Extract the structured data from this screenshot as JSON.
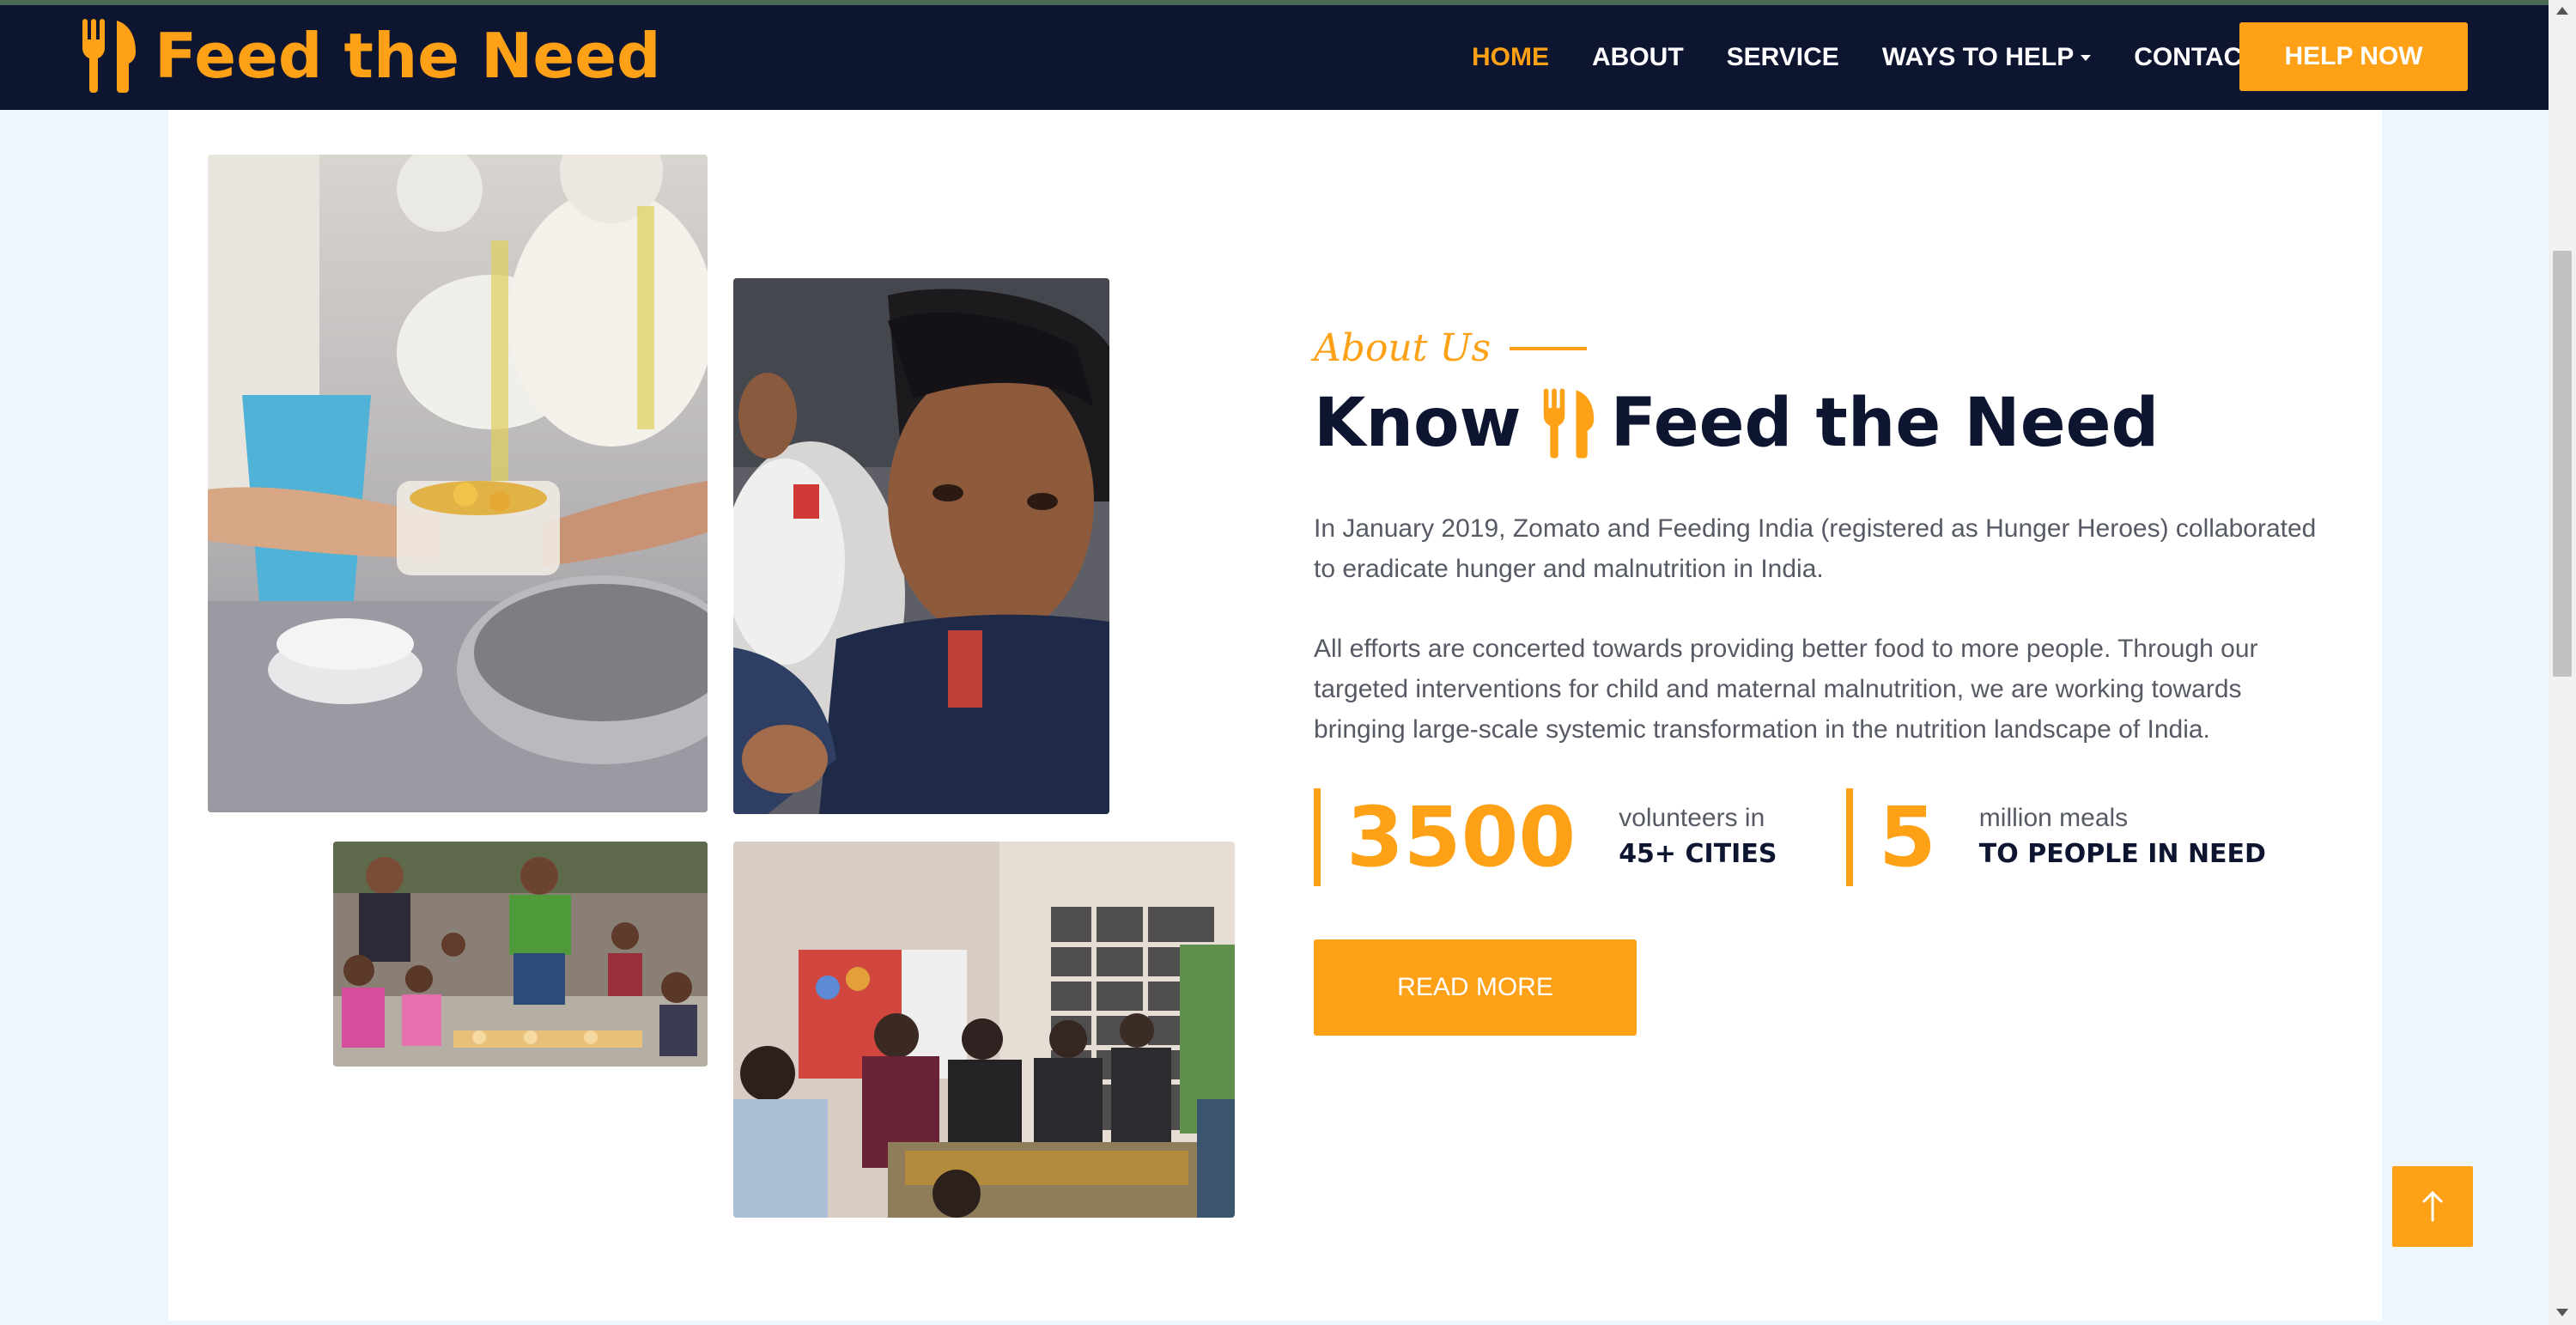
{
  "colors": {
    "accent": "#fea116",
    "navy": "#0d1530",
    "page_background": "#edf5fd",
    "body_text": "#555a64"
  },
  "brand": {
    "name": "Feed the Need",
    "icon": "fork-knife-icon"
  },
  "nav": {
    "items": [
      {
        "label": "HOME",
        "active": true
      },
      {
        "label": "ABOUT",
        "active": false
      },
      {
        "label": "SERVICE",
        "active": false
      },
      {
        "label": "WAYS TO HELP",
        "active": false,
        "dropdown": true
      },
      {
        "label": "CONTACT",
        "active": false
      }
    ],
    "cta_label": "HELP NOW"
  },
  "about": {
    "label": "About Us",
    "heading_prefix": "Know",
    "heading_icon": "fork-knife-icon",
    "heading_suffix": "Feed the Need",
    "paragraphs": [
      "In January 2019, Zomato and Feeding India (registered as Hunger Heroes) collaborated to eradicate hunger and malnutrition in India.",
      "All efforts are concerted towards providing better food to more people. Through our targeted interventions for child and maternal malnutrition, we are working towards bringing large-scale systemic transformation in the nutrition landscape of India."
    ],
    "stats": [
      {
        "number": "3500",
        "line1": "volunteers in",
        "line2": "45+ CITIES"
      },
      {
        "number": "5",
        "line1": "million meals",
        "line2": "TO PEOPLE IN NEED"
      }
    ],
    "button_label": "READ MORE"
  },
  "back_to_top_icon": "arrow-up-icon"
}
